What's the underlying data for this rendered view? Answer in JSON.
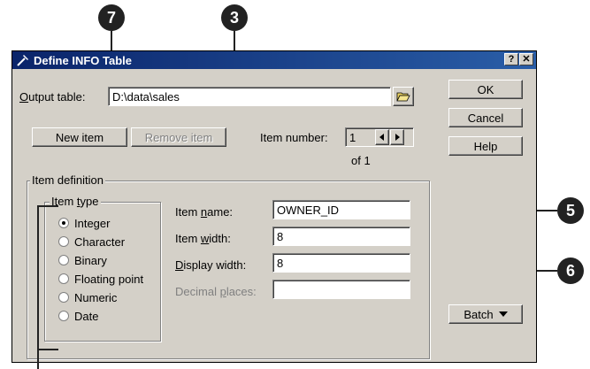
{
  "callouts": {
    "c7": "7",
    "c3": "3",
    "c5": "5",
    "c6": "6"
  },
  "dialog": {
    "title": "Define INFO Table",
    "help_button": "?",
    "close_button": "✕",
    "output_table": {
      "label": "Output table:",
      "value": "D:\\data\\sales"
    },
    "buttons": {
      "ok": "OK",
      "cancel": "Cancel",
      "help": "Help",
      "new_item": "New item",
      "remove_item": "Remove item",
      "batch": "Batch"
    },
    "item_number": {
      "label": "Item number:",
      "value": "1",
      "of": "of 1"
    },
    "item_definition": {
      "legend": "Item definition",
      "item_type": {
        "legend": "Item type",
        "options": [
          "Integer",
          "Character",
          "Binary",
          "Floating point",
          "Numeric",
          "Date"
        ],
        "selected": "Integer"
      },
      "fields": {
        "item_name": {
          "label": "Item name:",
          "value": "OWNER_ID"
        },
        "item_width": {
          "label": "Item width:",
          "value": "8"
        },
        "display_width": {
          "label": "Display width:",
          "value": "8"
        },
        "decimal_places": {
          "label": "Decimal places:",
          "value": ""
        }
      }
    }
  },
  "colors": {
    "titlebar_start": "#0a246a",
    "titlebar_end": "#2a5ea8",
    "face": "#d4d0c8",
    "callout": "#222222"
  }
}
